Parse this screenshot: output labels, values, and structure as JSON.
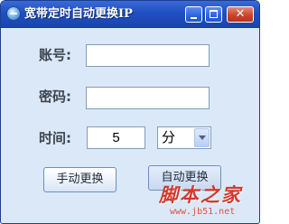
{
  "window": {
    "title": "宽带定时自动更换IP",
    "close_glyph": "✕"
  },
  "form": {
    "account_label": "账号:",
    "account_value": "",
    "password_label": "密码:",
    "password_value": "",
    "time_label": "时间:",
    "time_value": "5",
    "unit_selected": "分"
  },
  "buttons": {
    "manual_label": "手动更换",
    "auto_label": "自动更换"
  },
  "watermark": {
    "text": "脚本之家",
    "url": "www.jb51.net"
  },
  "colors": {
    "titlebar": "#1f4fc1",
    "window_bg": "#dbe8f7",
    "close_button": "#c9452c",
    "watermark": "#d33a2e"
  },
  "icons": {
    "app": "network-globe-icon",
    "minimize": "minimize-icon",
    "maximize": "maximize-icon",
    "close": "close-icon",
    "dropdown": "chevron-down-icon"
  }
}
